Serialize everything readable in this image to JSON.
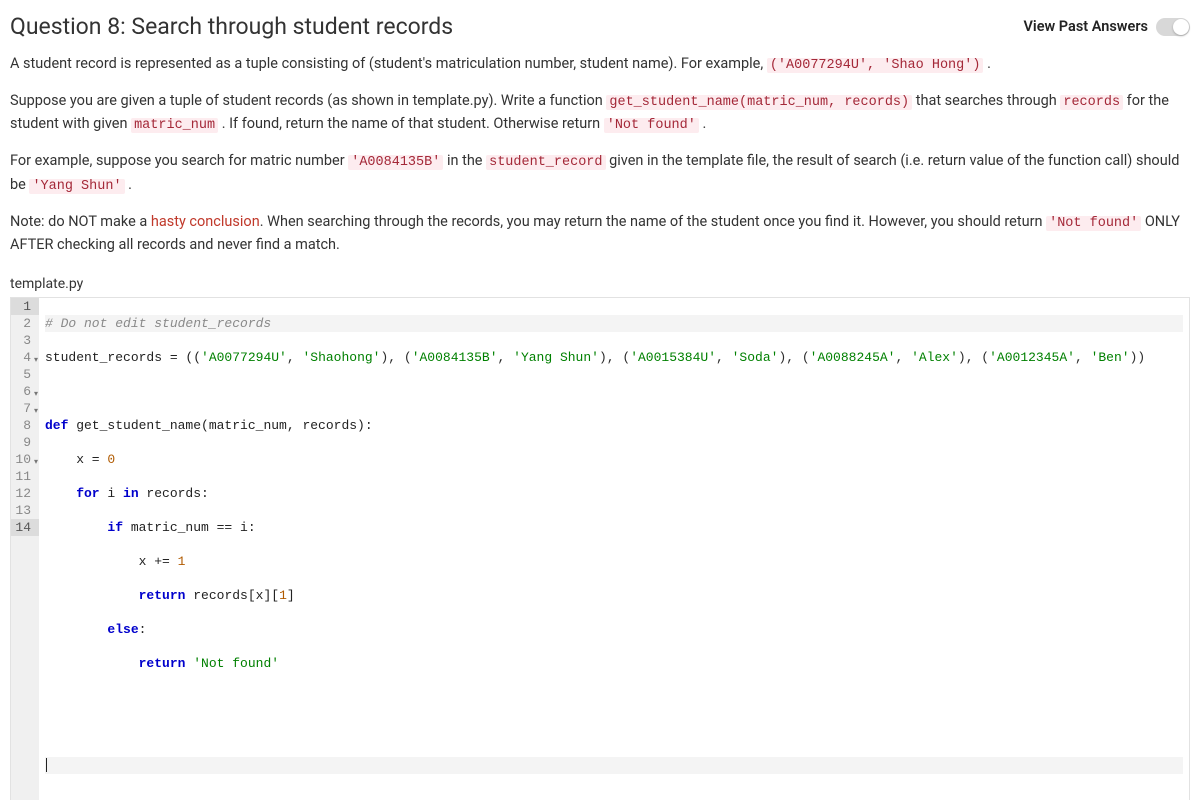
{
  "header": {
    "title": "Question 8: Search through student records",
    "past_answers_label": "View Past Answers"
  },
  "p1": {
    "t0": "A student record is represented as a tuple consisting of (student's matriculation number, student name). For example, ",
    "c0": "('A0077294U', 'Shao Hong')",
    "t1": " ."
  },
  "p2": {
    "t0": "Suppose you are given a tuple of student records (as shown in template.py). Write a function ",
    "c0": "get_student_name(matric_num, records)",
    "t1": " that searches through ",
    "c1": "records",
    "t2": " for the student with given ",
    "c2": "matric_num",
    "t3": " . If found, return the name of that student. Otherwise return ",
    "c3": "'Not found'",
    "t4": " ."
  },
  "p3": {
    "t0": "For example, suppose you search for matric number ",
    "c0": "'A0084135B'",
    "t1": " in the ",
    "c1": "student_record",
    "t2": " given in the template file, the result of search (i.e. return value of the function call) should be ",
    "c2": "'Yang Shun'",
    "t3": " ."
  },
  "p4": {
    "t0": "Note: do NOT make a ",
    "hasty": "hasty conclusion",
    "t1": ". When searching through the records, you may return the name of the student once you find it. However, you should return ",
    "c0": "'Not found'",
    "t2": " ONLY AFTER checking all records and never find a match."
  },
  "editor": {
    "filename": "template.py",
    "lines": {
      "l1_comment": "# Do not edit student_records",
      "l2_a": "student_records = ((",
      "l2_s1": "'A0077294U'",
      "l2_c1": ", ",
      "l2_s2": "'Shaohong'",
      "l2_c2": "), (",
      "l2_s3": "'A0084135B'",
      "l2_c3": ", ",
      "l2_s4": "'Yang Shun'",
      "l2_c4": "), (",
      "l2_s5": "'A0015384U'",
      "l2_c5": ", ",
      "l2_s6": "'Soda'",
      "l2_c6": "), (",
      "l2_s7": "'A0088245A'",
      "l2_c7": ", ",
      "l2_s8": "'Alex'",
      "l2_c8": "), (",
      "l2_s9": "'A0012345A'",
      "l2_c9": ", ",
      "l2_s10": "'Ben'",
      "l2_c10": "))",
      "l4_def": "def",
      "l4_rest": " get_student_name(matric_num, records):",
      "l5_a": "    x = ",
      "l5_n": "0",
      "l6_for": "    for",
      "l6_rest": " i ",
      "l6_in": "in",
      "l6_rest2": " records:",
      "l7_if": "        if",
      "l7_rest": " matric_num == i:",
      "l8_a": "            x += ",
      "l8_n": "1",
      "l9_ret": "            return",
      "l9_rest": " records[x][",
      "l9_n": "1",
      "l9_rest2": "]",
      "l10_else": "        else",
      "l10_colon": ":",
      "l11_ret": "            return",
      "l11_sp": " ",
      "l11_str": "'Not found'"
    },
    "gutters": [
      "1",
      "2",
      "3",
      "4",
      "5",
      "6",
      "7",
      "8",
      "9",
      "10",
      "11",
      "12",
      "13",
      "14"
    ]
  }
}
